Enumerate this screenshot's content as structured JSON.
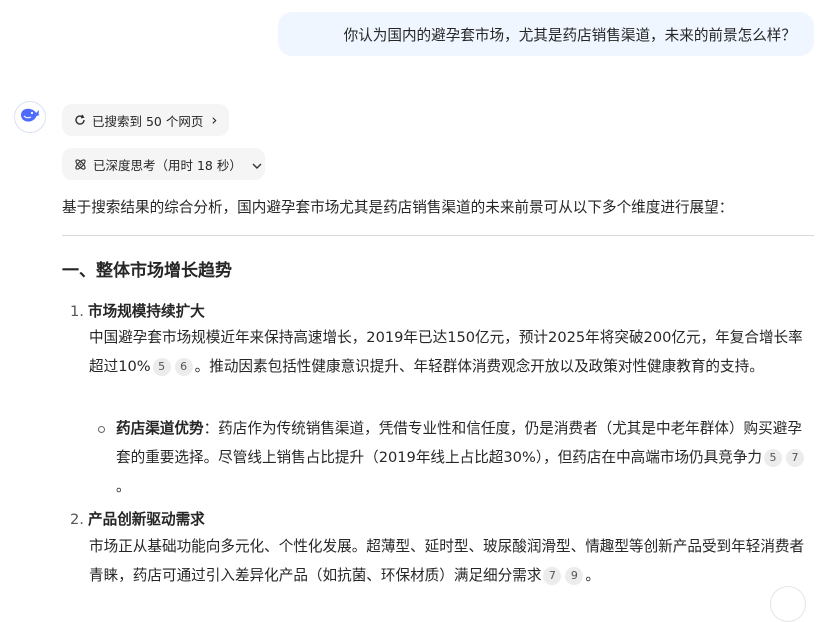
{
  "user_message": "你认为国内的避孕套市场，尤其是药店销售渠道，未来的前景怎么样？",
  "assistant": {
    "avatar_icon": "whale-logo-icon",
    "search_chip": {
      "label": "已搜索到 50 个网页",
      "icon": "refresh-icon",
      "chevron": "›"
    },
    "think_chip": {
      "label": "已深度思考（用时 18 秒）",
      "icon": "atom-icon",
      "chevron": "⌄"
    },
    "intro": "基于搜索结果的综合分析，国内避孕套市场尤其是药店销售渠道的未来前景可从以下多个维度进行展望：",
    "section_title": "一、整体市场增长趋势",
    "items": [
      {
        "num": "1.",
        "title": "市场规模持续扩大",
        "text": "中国避孕套市场规模近年来保持高速增长，2019年已达150亿元，预计2025年将突破200亿元，年复合增长率超过10%",
        "cites": [
          "5",
          "6"
        ],
        "text_after": "。推动因素包括性健康意识提升、年轻群体消费观念开放以及政策对性健康教育的支持。",
        "sub": {
          "bold": "药店渠道优势",
          "text": "：药店作为传统销售渠道，凭借专业性和信任度，仍是消费者（尤其是中老年群体）购买避孕套的重要选择。尽管线上销售占比提升（2019年线上占比超30%），但药店在中高端市场仍具竞争力",
          "cites": [
            "5",
            "7"
          ],
          "text_after": "。"
        }
      },
      {
        "num": "2.",
        "title": "产品创新驱动需求",
        "text": "市场正从基础功能向多元化、个性化发展。超薄型、延时型、玻尿酸润滑型、情趣型等创新产品受到年轻消费者青睐，药店可通过引入差异化产品（如抗菌、环保材质）满足细分需求",
        "cites": [
          "7",
          "9"
        ],
        "text_after": "。"
      }
    ]
  },
  "colors": {
    "bubble": "#eff6ff",
    "chip": "#f5f5f5",
    "cite_bg": "#ececec",
    "logo": "#4d6bfe"
  }
}
